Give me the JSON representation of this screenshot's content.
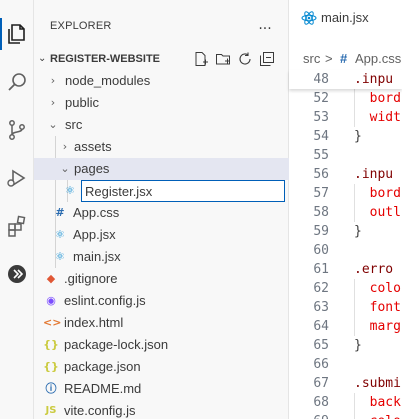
{
  "explorer": {
    "title": "EXPLORER",
    "more": "···",
    "section_title": "REGISTER-WEBSITE",
    "rename_value": "Register.jsx",
    "tree": [
      {
        "label": "node_modules",
        "kind": "folder",
        "expanded": false,
        "depth": 1
      },
      {
        "label": "public",
        "kind": "folder",
        "expanded": false,
        "depth": 1
      },
      {
        "label": "src",
        "kind": "folder",
        "expanded": true,
        "depth": 1
      },
      {
        "label": "assets",
        "kind": "folder",
        "expanded": false,
        "depth": 2
      },
      {
        "label": "pages",
        "kind": "folder",
        "expanded": true,
        "depth": 2
      },
      {
        "label": "App.css",
        "kind": "css",
        "depth": 2
      },
      {
        "label": "App.jsx",
        "kind": "react",
        "depth": 2
      },
      {
        "label": "main.jsx",
        "kind": "react",
        "depth": 2
      },
      {
        "label": ".gitignore",
        "kind": "git",
        "depth": 1
      },
      {
        "label": "eslint.config.js",
        "kind": "eslint",
        "depth": 1
      },
      {
        "label": "index.html",
        "kind": "html",
        "depth": 1
      },
      {
        "label": "package-lock.json",
        "kind": "json",
        "depth": 1
      },
      {
        "label": "package.json",
        "kind": "json",
        "depth": 1
      },
      {
        "label": "README.md",
        "kind": "info",
        "depth": 1
      },
      {
        "label": "vite.config.js",
        "kind": "js",
        "depth": 1
      }
    ]
  },
  "editor": {
    "tab_label": "main.jsx",
    "breadcrumb": [
      "src",
      ">",
      "#",
      "App.css"
    ],
    "lines": [
      {
        "n": "48",
        "text": ".inpu",
        "cls": "sel-name"
      },
      {
        "n": "52",
        "text": "  bord",
        "cls": "prop"
      },
      {
        "n": "53",
        "text": "  widt",
        "cls": "prop"
      },
      {
        "n": "54",
        "text": "}",
        "cls": "brace"
      },
      {
        "n": "55",
        "text": "",
        "cls": "brace"
      },
      {
        "n": "56",
        "text": ".inpu",
        "cls": "sel-name"
      },
      {
        "n": "57",
        "text": "  bord",
        "cls": "prop"
      },
      {
        "n": "58",
        "text": "  outl",
        "cls": "prop"
      },
      {
        "n": "59",
        "text": "}",
        "cls": "brace"
      },
      {
        "n": "60",
        "text": "",
        "cls": "brace"
      },
      {
        "n": "61",
        "text": ".erro",
        "cls": "sel-name"
      },
      {
        "n": "62",
        "text": "  colo",
        "cls": "prop"
      },
      {
        "n": "63",
        "text": "  font",
        "cls": "prop"
      },
      {
        "n": "64",
        "text": "  marg",
        "cls": "prop"
      },
      {
        "n": "65",
        "text": "}",
        "cls": "brace"
      },
      {
        "n": "66",
        "text": "",
        "cls": "brace"
      },
      {
        "n": "67",
        "text": ".submi",
        "cls": "sel-name"
      },
      {
        "n": "68",
        "text": "  back",
        "cls": "prop"
      },
      {
        "n": "69",
        "text": "  colo",
        "cls": "prop"
      }
    ]
  },
  "colors": {
    "accent": "#005fb8",
    "react": "#0288d1",
    "css": "#2b6cb0",
    "json": "#cbcb41",
    "html": "#e37933",
    "git": "#e05735",
    "eslint": "#7c4dff"
  }
}
